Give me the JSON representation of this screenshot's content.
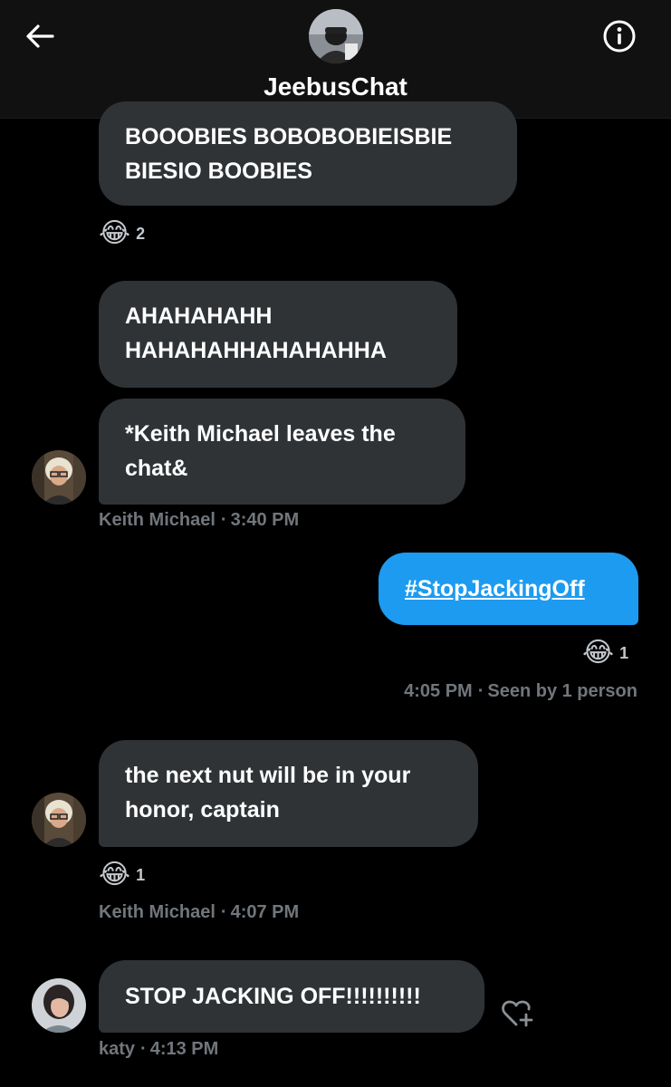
{
  "header": {
    "title": "JeebusChat",
    "back_icon": "arrow-left-icon",
    "info_icon": "info-circle-icon"
  },
  "messages": [
    {
      "lines": [
        "BOOOBIES BOBOBOBIEISBIE",
        "BIESIO BOOBIES"
      ],
      "reaction": {
        "emoji": "😂",
        "count": "2"
      }
    },
    {
      "lines": [
        "AHAHAHAHH",
        "HAHAHAHHAHAHAHHA"
      ]
    },
    {
      "lines": [
        "*Keith Michael leaves the",
        "chat&"
      ],
      "sender": "Keith Michael",
      "time": "3:40 PM"
    },
    {
      "lines": [
        "#StopJackingOff"
      ],
      "reaction": {
        "emoji": "😂",
        "count": "1"
      },
      "time": "4:05 PM",
      "status": "Seen by 1 person"
    },
    {
      "lines": [
        "the next nut will be in your",
        "honor, captain"
      ],
      "reaction": {
        "emoji": "😂",
        "count": "1"
      },
      "sender": "Keith Michael",
      "time": "4:07 PM"
    },
    {
      "lines": [
        "STOP JACKING OFF!!!!!!!!!!"
      ],
      "sender": "katy",
      "time": "4:13 PM"
    }
  ],
  "separator": "·",
  "colors": {
    "background": "#000000",
    "header": "#111111",
    "bubble_received": "#2f3336",
    "bubble_sent": "#1d9bf0",
    "meta_text": "#71767b"
  }
}
